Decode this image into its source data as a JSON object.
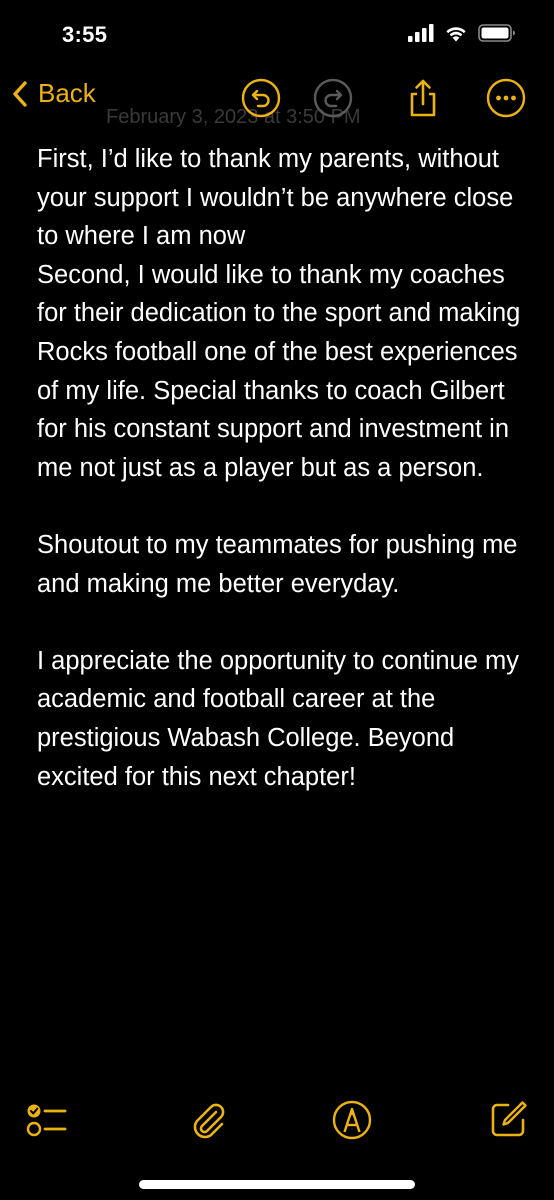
{
  "status_bar": {
    "time": "3:55",
    "icons": [
      "signal-bars-icon",
      "wifi-icon",
      "battery-icon"
    ]
  },
  "nav": {
    "back_label": "Back",
    "date_text": "February 3, 2023 at 3:50 PM",
    "buttons": [
      "undo-icon",
      "redo-icon",
      "share-icon",
      "more-icon"
    ]
  },
  "note": {
    "paragraphs": [
      "First, I’d like to thank my parents, without your support I wouldn’t be anywhere close to where I am now",
      "Second, I would like to thank my coaches for their dedication to the sport and making Rocks football one of the best experiences of my life. Special thanks to coach Gilbert for his constant support and investment in me not just as a player but as a person.",
      "Shoutout to my teammates for pushing me and making me better everyday.",
      "I appreciate the opportunity to continue my academic and football career at the prestigious Wabash College. Beyond excited for this next chapter!"
    ]
  },
  "toolbar": {
    "buttons": [
      "checklist-icon",
      "paperclip-icon",
      "markup-pen-icon",
      "compose-icon"
    ]
  },
  "colors": {
    "accent": "#ebb214",
    "background": "#000000",
    "text": "#ffffff"
  }
}
